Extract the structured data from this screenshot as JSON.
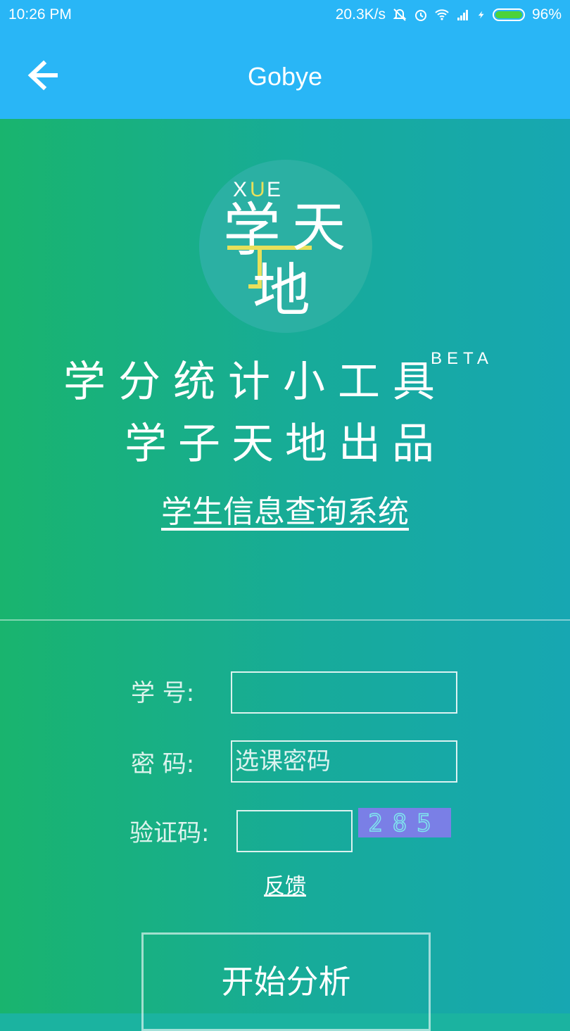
{
  "status_bar": {
    "time": "10:26 PM",
    "network_speed": "20.3K/s",
    "battery": "96%",
    "icons": [
      "mute-icon",
      "alarm-icon",
      "wifi-icon",
      "signal-icon",
      "charging-icon",
      "battery-icon"
    ]
  },
  "app_bar": {
    "title": "Gobye",
    "back_icon": "arrow-left-icon"
  },
  "colors": {
    "app_bar": "#29b6f6",
    "gradient_start": "#19b46e",
    "gradient_end": "#17a7b2",
    "logo_yellow": "#e8e05a",
    "captcha_bg": "#7a7fe6"
  },
  "logo": {
    "name": "xue-tian-di-logo",
    "text_top": "XUE",
    "chars": [
      "学",
      "天",
      "子",
      "地"
    ]
  },
  "heading": {
    "line1": "学分统计小工具",
    "beta": "BETA",
    "line2": "学子天地出品",
    "system_link": "学生信息查询系统"
  },
  "form": {
    "student_id_label": "学 号:",
    "student_id_value": "",
    "password_label": "密 码:",
    "password_placeholder": "选课密码",
    "captcha_label": "验证码:",
    "captcha_value": "",
    "captcha_image_text": "285",
    "feedback": "反馈",
    "submit": "开始分析"
  }
}
